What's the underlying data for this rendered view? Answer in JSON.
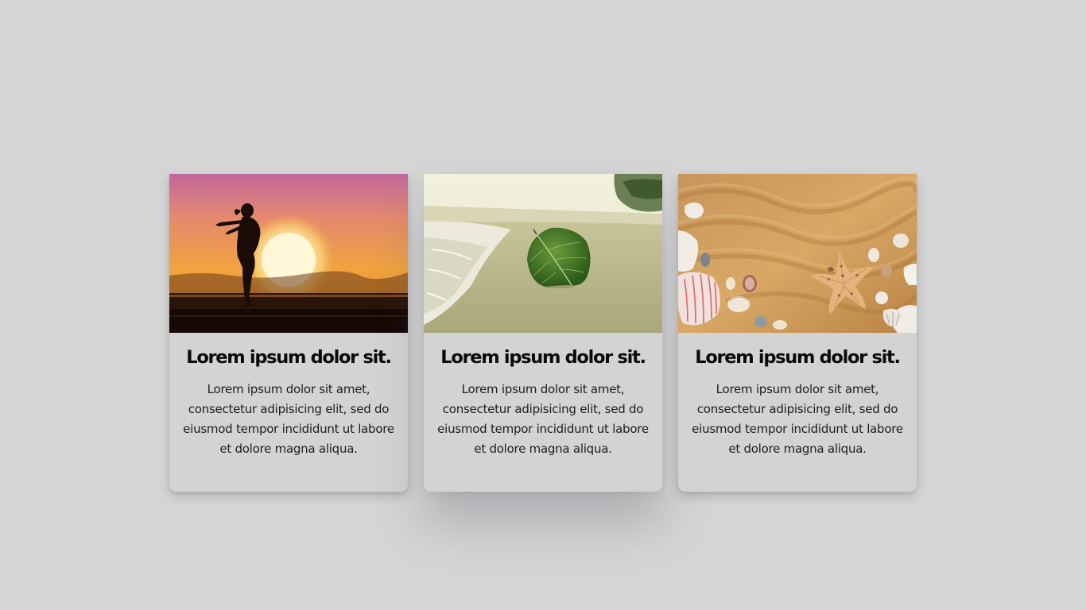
{
  "page": {
    "background_color": "#d5d5d5",
    "card_color": "#d3d3d3"
  },
  "cards": [
    {
      "image": "sunset-silhouette-image",
      "title": "Lorem ipsum dolor sit.",
      "text": "Lorem ipsum dolor sit amet, consectetur adipisicing elit, sed do eiusmod tempor incididunt ut labore et dolore magna aliqua."
    },
    {
      "image": "beach-leaf-image",
      "title": "Lorem ipsum dolor sit.",
      "text": "Lorem ipsum dolor sit amet, consectetur adipisicing elit, sed do eiusmod tempor incididunt ut labore et dolore magna aliqua."
    },
    {
      "image": "seashells-sand-image",
      "title": "Lorem ipsum dolor sit.",
      "text": "Lorem ipsum dolor sit amet, consectetur adipisicing elit, sed do eiusmod tempor incididunt ut labore et dolore magna aliqua."
    }
  ]
}
